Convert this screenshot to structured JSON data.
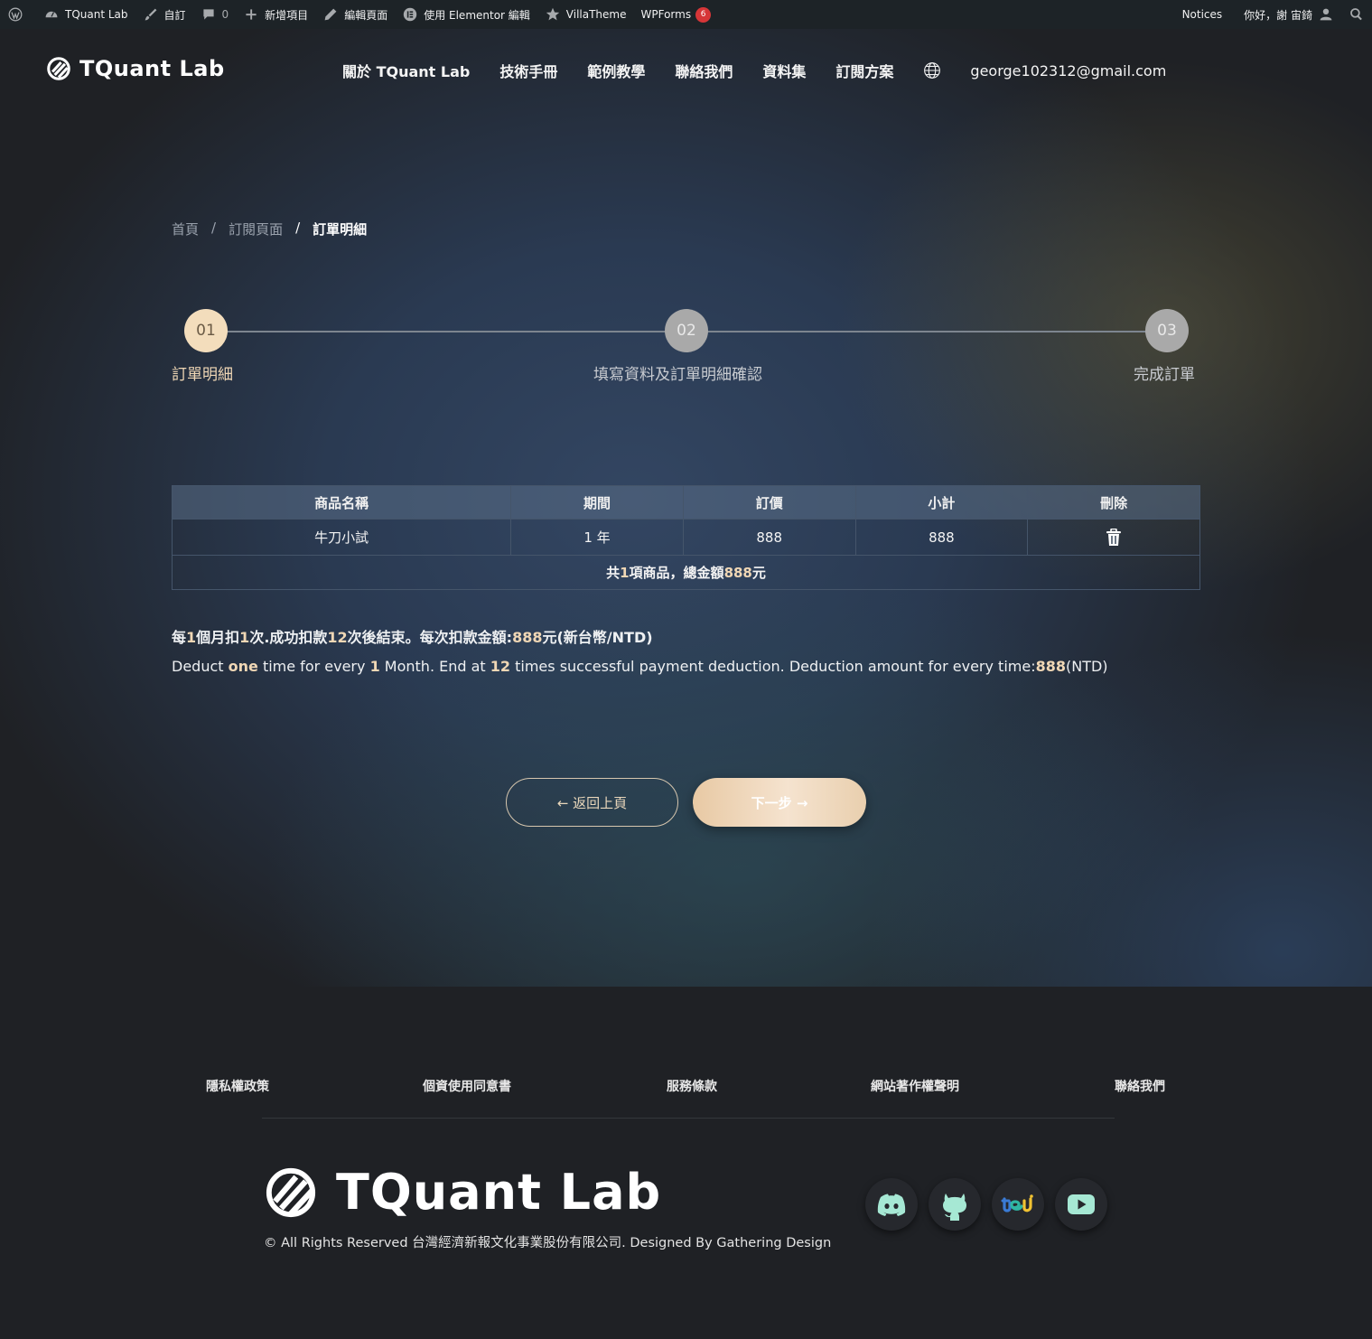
{
  "adminbar": {
    "site_name": "TQuant Lab",
    "customize": "自訂",
    "comments_count": "0",
    "new_item": "新增項目",
    "edit_page": "編輯頁面",
    "elementor_edit": "使用 Elementor 編輯",
    "villatheme": "VillaTheme",
    "wpforms": "WPForms",
    "wpforms_badge": "6",
    "notices": "Notices",
    "greeting": "你好，謝 宙錡"
  },
  "header": {
    "logo_text": "TQuant Lab",
    "nav": [
      {
        "label": "關於 TQuant Lab"
      },
      {
        "label": "技術手冊"
      },
      {
        "label": "範例教學"
      },
      {
        "label": "聯絡我們"
      },
      {
        "label": "資料集"
      },
      {
        "label": "訂閱方案"
      }
    ],
    "email": "george102312@gmail.com"
  },
  "breadcrumb": {
    "home": "首頁",
    "sep": "/",
    "subscribe": "訂閱頁面",
    "current": "訂單明細"
  },
  "steps": [
    {
      "num": "01",
      "label": "訂單明細",
      "active": true
    },
    {
      "num": "02",
      "label": "填寫資料及訂單明細確認",
      "active": false
    },
    {
      "num": "03",
      "label": "完成訂單",
      "active": false
    }
  ],
  "cart": {
    "headers": [
      "商品名稱",
      "期間",
      "訂價",
      "小計",
      "刪除"
    ],
    "rows": [
      {
        "name": "牛刀小試",
        "period": "1 年",
        "price": "888",
        "subtotal": "888"
      }
    ],
    "total": {
      "pre": "共",
      "count": "1",
      "mid": "項商品，總金額",
      "amount": "888",
      "post": "元"
    }
  },
  "notice_zh": {
    "p1": "每",
    "v1": "1",
    "p2": "個月扣",
    "v2": "1",
    "p3": "次.成功扣款",
    "v3": "12",
    "p4": "次後結束。每次扣款金額:",
    "v4": "888",
    "p5": "元(新台幣/NTD)"
  },
  "notice_en": {
    "p1": "Deduct ",
    "v1": "one",
    "p2": " time for every ",
    "v2": "1",
    "p3": " Month. End at ",
    "v3": "12",
    "p4": " times successful payment deduction. Deduction amount for every time:",
    "v4": "888",
    "p5": "(NTD)"
  },
  "buttons": {
    "back": "← 返回上頁",
    "next": "下一步 →"
  },
  "footer": {
    "links": [
      "隱私權政策",
      "個資使用同意書",
      "服務條款",
      "網站著作權聲明",
      "聯絡我們"
    ],
    "logo_text": "TQuant Lab",
    "copyright": "© All Rights Reserved 台灣經濟新報文化事業股份有限公司. Designed By Gathering Design",
    "social": [
      "discord-icon",
      "github-icon",
      "tej-icon",
      "youtube-icon"
    ]
  },
  "colors": {
    "accent": "#f0d7b5",
    "social_icon": "#a6e8d4",
    "badge": "#d63638"
  }
}
